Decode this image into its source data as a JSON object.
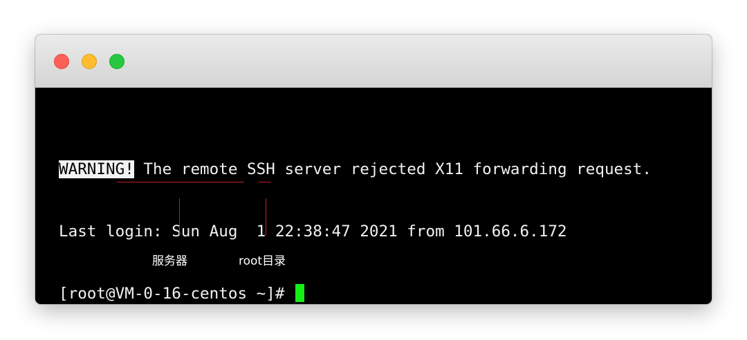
{
  "window": {
    "traffic_lights": {
      "close_color": "#fe5f57",
      "minimize_color": "#febc2e",
      "zoom_color": "#28c840"
    }
  },
  "terminal": {
    "line1": {
      "highlight": "WARNING!",
      "text": " The remote SSH server rejected X11 forwarding request."
    },
    "line2": {
      "text": "Last login: Sun Aug  1 22:38:47 2021 from 101.66.6.172"
    },
    "prompt": {
      "open": "[root@",
      "hostname": "VM-0-16-centos",
      "space": " ",
      "directory": "~",
      "close": "]# "
    },
    "cursor_color": "#14f014"
  },
  "annotations": {
    "hostname_label": "服务器",
    "directory_label": "root目录",
    "line_color": "#c42020"
  }
}
